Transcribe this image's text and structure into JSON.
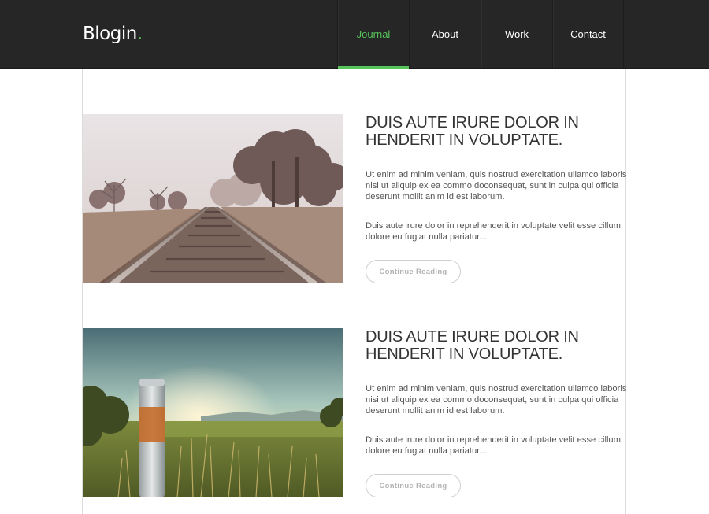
{
  "header": {
    "logo": "Blogin",
    "logo_dot": ".",
    "nav": [
      {
        "label": "Journal",
        "active": true
      },
      {
        "label": "About",
        "active": false
      },
      {
        "label": "Work",
        "active": false
      },
      {
        "label": "Contact",
        "active": false
      }
    ]
  },
  "colors": {
    "accent": "#57c35b",
    "header_bg": "#262626"
  },
  "posts": [
    {
      "image": "railway-tracks-photo",
      "title": "DUIS AUTE IRURE DOLOR IN HENDERIT IN VOLUPTATE.",
      "para1": "Ut enim ad minim veniam, quis nostrud exercitation ullamco laboris nisi ut aliquip ex ea commo doconsequat, sunt in culpa qui officia deserunt mollit anim id est laborum.",
      "para2": "Duis aute irure dolor in reprehenderit in voluptate velit esse cillum dolore eu fugiat nulla pariatur...",
      "button": "Continue Reading"
    },
    {
      "image": "sunset-field-photo",
      "title": "DUIS AUTE IRURE DOLOR IN HENDERIT IN VOLUPTATE.",
      "para1": "Ut enim ad minim veniam, quis nostrud exercitation ullamco laboris nisi ut aliquip ex ea commo doconsequat, sunt in culpa qui officia deserunt mollit anim id est laborum.",
      "para2": "Duis aute irure dolor in reprehenderit in voluptate velit esse cillum dolore eu fugiat nulla pariatur...",
      "button": "Continue Reading"
    }
  ]
}
